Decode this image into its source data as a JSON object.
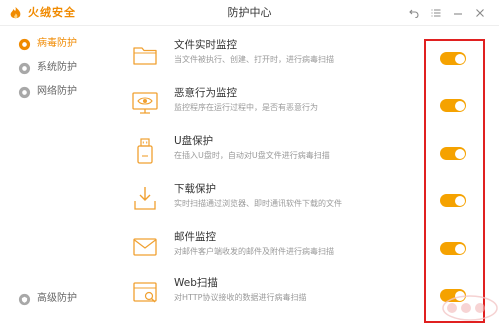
{
  "app": {
    "brand": "火绒安全",
    "window_title": "防护中心"
  },
  "window_controls": [
    {
      "name": "back-icon"
    },
    {
      "name": "menu-icon"
    },
    {
      "name": "minimize-icon"
    },
    {
      "name": "close-icon"
    }
  ],
  "sidebar": {
    "items": [
      {
        "label": "病毒防护",
        "icon": "shield-icon",
        "active": true
      },
      {
        "label": "系统防护",
        "icon": "system-icon",
        "active": false
      },
      {
        "label": "网络防护",
        "icon": "globe-icon",
        "active": false
      }
    ],
    "bottom_item": {
      "label": "高级防护",
      "icon": "advanced-shield-icon"
    }
  },
  "features": [
    {
      "title": "文件实时监控",
      "desc": "当文件被执行、创建、打开时，进行病毒扫描",
      "icon": "folder-icon",
      "enabled": true
    },
    {
      "title": "恶意行为监控",
      "desc": "监控程序在运行过程中，是否有恶意行为",
      "icon": "monitor-eye-icon",
      "enabled": true
    },
    {
      "title": "U盘保护",
      "desc": "在插入U盘时，自动对U盘文件进行病毒扫描",
      "icon": "usb-drive-icon",
      "enabled": true
    },
    {
      "title": "下载保护",
      "desc": "实时扫描通过浏览器、即时通讯软件下载的文件",
      "icon": "download-icon",
      "enabled": true
    },
    {
      "title": "邮件监控",
      "desc": "对邮件客户端收发的邮件及附件进行病毒扫描",
      "icon": "mail-icon",
      "enabled": true
    },
    {
      "title": "Web扫描",
      "desc": "对HTTP协议接收的数据进行病毒扫描",
      "icon": "web-scan-icon",
      "enabled": true
    }
  ],
  "colors": {
    "accent": "#f08a00",
    "toggle_on": "#f5a200",
    "highlight": "#e02020",
    "icon_stroke": "#f0a030"
  }
}
